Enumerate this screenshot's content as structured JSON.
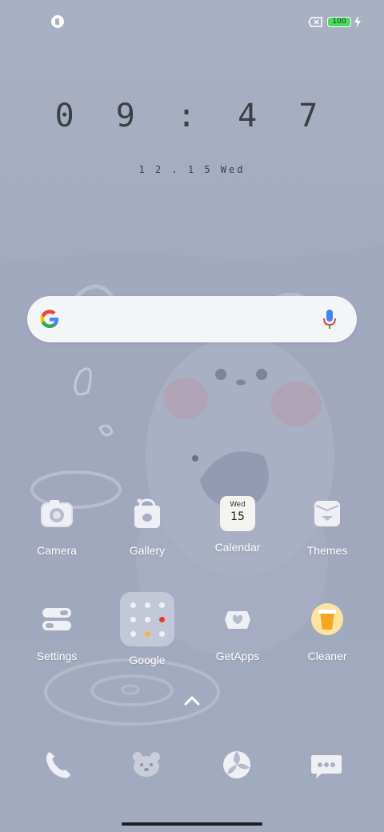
{
  "status_bar": {
    "battery_level": "100"
  },
  "clock": {
    "time": "0 9 : 4 7",
    "date": "1 2 . 1 5   Wed"
  },
  "search": {
    "logo": "google-g-icon",
    "mic": "mic-icon"
  },
  "apps_row1": [
    {
      "label": "Camera",
      "icon": "camera-icon"
    },
    {
      "label": "Gallery",
      "icon": "gallery-icon"
    },
    {
      "label": "Calendar",
      "icon": "calendar-icon",
      "icon_day": "Wed",
      "icon_date": "15"
    },
    {
      "label": "Themes",
      "icon": "themes-icon"
    }
  ],
  "apps_row2": [
    {
      "label": "Settings",
      "icon": "settings-icon"
    },
    {
      "label": "Google",
      "icon": "folder-icon"
    },
    {
      "label": "GetApps",
      "icon": "getapps-icon"
    },
    {
      "label": "Cleaner",
      "icon": "cleaner-icon"
    }
  ],
  "dock": [
    {
      "icon": "phone-icon"
    },
    {
      "icon": "bear-icon"
    },
    {
      "icon": "browser-icon"
    },
    {
      "icon": "messages-icon"
    }
  ],
  "colors": {
    "icon_white": "#f4f5f8",
    "accent_orange": "#f5a623",
    "battery_green": "#4cd964"
  }
}
